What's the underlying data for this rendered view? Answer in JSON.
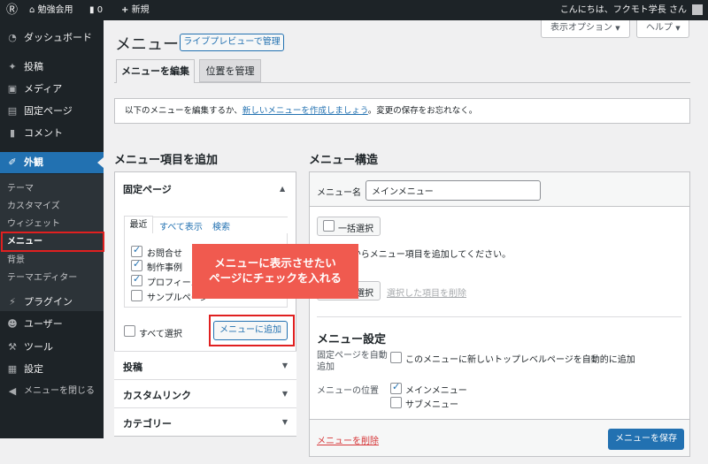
{
  "adminbar": {
    "site_name": "勉強会用",
    "comments_count": "0",
    "new_label": "新規",
    "greeting": "こんにちは、フクモト学長 さん"
  },
  "sidebar": {
    "items": [
      {
        "label": "ダッシュボード",
        "icon": "dashboard-icon"
      },
      {
        "label": "投稿",
        "icon": "pin-icon"
      },
      {
        "label": "メディア",
        "icon": "media-icon"
      },
      {
        "label": "固定ページ",
        "icon": "page-icon"
      },
      {
        "label": "コメント",
        "icon": "comment-icon"
      },
      {
        "label": "外観",
        "icon": "brush-icon"
      }
    ],
    "appearance_sub": [
      "テーマ",
      "カスタマイズ",
      "ウィジェット",
      "メニュー",
      "背景",
      "テーマエディター"
    ],
    "items_after": [
      {
        "label": "プラグイン",
        "icon": "plugin-icon"
      },
      {
        "label": "ユーザー",
        "icon": "user-icon"
      },
      {
        "label": "ツール",
        "icon": "tool-icon"
      },
      {
        "label": "設定",
        "icon": "settings-icon"
      },
      {
        "label": "メニューを閉じる",
        "icon": "collapse-icon"
      }
    ]
  },
  "header": {
    "title": "メニュー",
    "live_preview": "ライブプレビューで管理",
    "screen_options": "表示オプション",
    "help": "ヘルプ"
  },
  "tabs": [
    "メニューを編集",
    "位置を管理"
  ],
  "notice": {
    "before": "以下のメニューを編集するか、",
    "link": "新しいメニューを作成しましょう",
    "after": "。変更の保存をお忘れなく。"
  },
  "add_items": {
    "heading": "メニュー項目を追加",
    "pages_title": "固定ページ",
    "subtabs": [
      "最近",
      "すべて表示",
      "検索"
    ],
    "pages": [
      {
        "label": "お問合せ",
        "checked": true
      },
      {
        "label": "制作事例",
        "checked": true
      },
      {
        "label": "プロフィール",
        "checked": true
      },
      {
        "label": "サンプルページ",
        "checked": false
      }
    ],
    "select_all": "すべて選択",
    "add_button": "メニューに追加",
    "sections": [
      "投稿",
      "カスタムリンク",
      "カテゴリー"
    ]
  },
  "structure": {
    "heading": "メニュー構造",
    "name_label": "メニュー名",
    "name_value": "メインメニュー",
    "bulk_select": "一括選択",
    "instruction": "左カラムからメニュー項目を追加してください。",
    "remove_selected": "選択した項目を削除",
    "settings_heading": "メニュー設定",
    "auto_add_label": "固定ページを自動追加",
    "auto_add_option": "このメニューに新しいトップレベルページを自動的に追加",
    "location_label": "メニューの位置",
    "locations": [
      {
        "label": "メインメニュー",
        "checked": true
      },
      {
        "label": "サブメニュー",
        "checked": false
      }
    ],
    "delete_menu": "メニューを削除",
    "save_button": "メニューを保存"
  },
  "callout": {
    "line1": "メニューに表示させたい",
    "line2": "ページにチェックを入れる"
  },
  "colors": {
    "accent": "#2271b1",
    "adminbar": "#1d2327",
    "highlight": "#e02020",
    "callout": "#f05a4f"
  }
}
